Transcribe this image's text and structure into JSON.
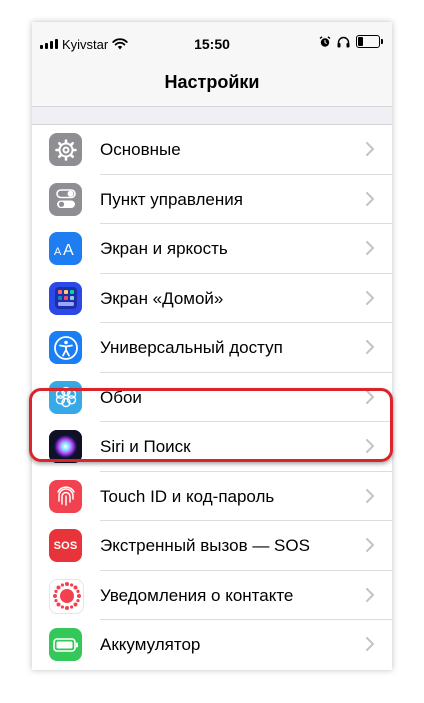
{
  "status_bar": {
    "carrier": "Kyivstar",
    "time": "15:50",
    "battery_level": 0.25
  },
  "nav": {
    "title": "Настройки"
  },
  "settings": [
    {
      "id": "general",
      "label": "Основные",
      "icon": "gear-icon",
      "color": "#8e8e93"
    },
    {
      "id": "control-center",
      "label": "Пункт управления",
      "icon": "switches-icon",
      "color": "#8e8e93"
    },
    {
      "id": "display",
      "label": "Экран и яркость",
      "icon": "text-size-icon",
      "color": "#1e7df0"
    },
    {
      "id": "home-screen",
      "label": "Экран «Домой»",
      "icon": "home-grid-icon",
      "color": "#2c48e8"
    },
    {
      "id": "accessibility",
      "label": "Универсальный доступ",
      "icon": "accessibility-icon",
      "color": "#1a7ef5"
    },
    {
      "id": "wallpaper",
      "label": "Обои",
      "icon": "flower-icon",
      "color": "#36a9e6"
    },
    {
      "id": "siri",
      "label": "Siri и Поиск",
      "icon": "siri-icon",
      "color": "#1b1b3a",
      "highlighted": true
    },
    {
      "id": "touch-id",
      "label": "Touch ID и код-пароль",
      "icon": "fingerprint-icon",
      "color": "#f2424f"
    },
    {
      "id": "sos",
      "label": "Экстренный вызов — SOS",
      "icon": "sos-icon",
      "color": "#e8333a",
      "icon_text": "SOS"
    },
    {
      "id": "exposure",
      "label": "Уведомления о контакте",
      "icon": "exposure-icon",
      "color": "#ffffff"
    },
    {
      "id": "battery",
      "label": "Аккумулятор",
      "icon": "battery-icon",
      "color": "#34c759"
    }
  ]
}
